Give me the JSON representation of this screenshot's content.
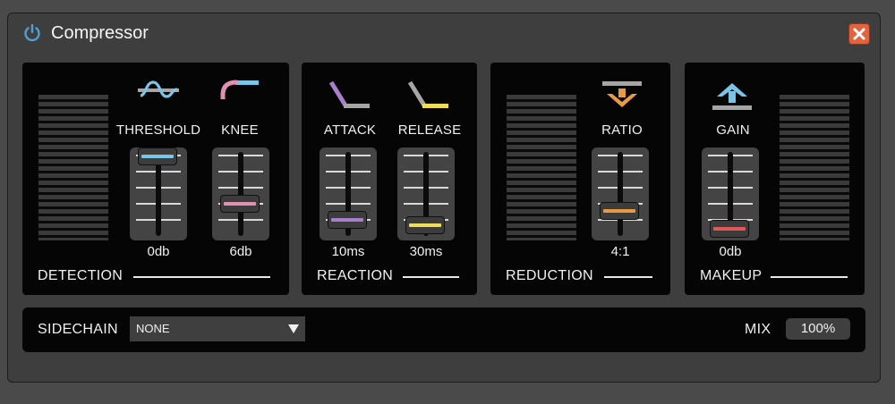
{
  "window": {
    "title": "Compressor"
  },
  "icons": {
    "power": "power-icon",
    "close": "close-icon",
    "threshold": "threshold-icon",
    "knee": "knee-icon",
    "attack": "attack-icon",
    "release": "release-icon",
    "ratio": "ratio-icon",
    "gain": "gain-icon",
    "dropdown": "chevron-down-icon"
  },
  "colors": {
    "threshold": "#7cc4e6",
    "knee": "#e190b2",
    "attack": "#a87fcb",
    "release": "#eedc5a",
    "ratio": "#e69a44",
    "gain": "#e05a5a",
    "close": "#e2643f",
    "power": "#4f9fd4"
  },
  "detection": {
    "label": "DETECTION",
    "threshold": {
      "label": "THRESHOLD",
      "value": "0db",
      "level": 1.0
    },
    "knee": {
      "label": "KNEE",
      "value": "6db",
      "level": 0.35
    }
  },
  "reaction": {
    "label": "REACTION",
    "attack": {
      "label": "ATTACK",
      "value": "10ms",
      "level": 0.12
    },
    "release": {
      "label": "RELEASE",
      "value": "30ms",
      "level": 0.05
    }
  },
  "reduction": {
    "label": "REDUCTION",
    "ratio": {
      "label": "RATIO",
      "value": "4:1",
      "level": 0.25
    }
  },
  "makeup": {
    "label": "MAKEUP",
    "gain": {
      "label": "GAIN",
      "value": "0db",
      "level": 0.0
    }
  },
  "sidechain": {
    "label": "SIDECHAIN",
    "selected": "NONE"
  },
  "mix": {
    "label": "MIX",
    "value": "100%"
  }
}
